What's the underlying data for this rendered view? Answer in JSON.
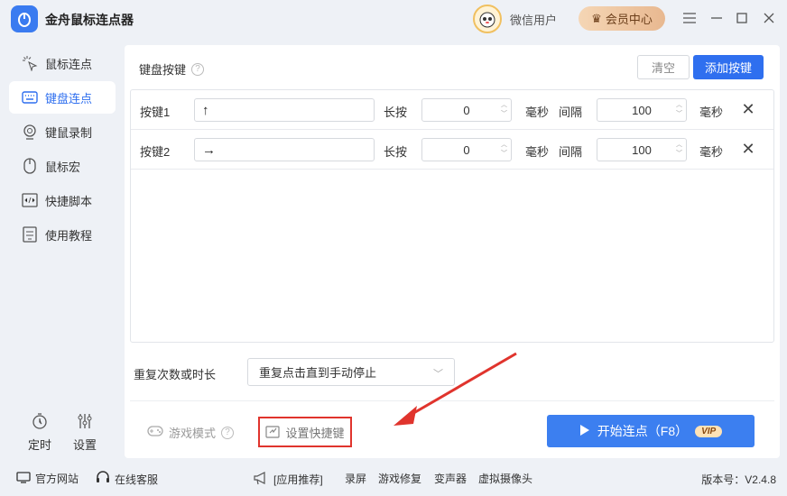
{
  "app": {
    "title": "金舟鼠标连点器",
    "user_name": "微信用户",
    "vip_label": "会员中心"
  },
  "colors": {
    "accent": "#2f6fef",
    "highlight_box": "#e0342d",
    "vip_gold": "#e8b890"
  },
  "sidebar": {
    "items": [
      {
        "label": "鼠标连点",
        "icon": "mouse-click-icon"
      },
      {
        "label": "键盘连点",
        "icon": "keyboard-icon",
        "active": true
      },
      {
        "label": "键鼠录制",
        "icon": "record-icon"
      },
      {
        "label": "鼠标宏",
        "icon": "mouse-icon"
      },
      {
        "label": "快捷脚本",
        "icon": "script-icon"
      },
      {
        "label": "使用教程",
        "icon": "tutorial-icon"
      }
    ],
    "bottom": [
      {
        "label": "定时",
        "icon": "timer-icon"
      },
      {
        "label": "设置",
        "icon": "settings-icon"
      }
    ]
  },
  "main": {
    "section_title": "键盘按键",
    "clear_label": "清空",
    "add_label": "添加按键",
    "keys": [
      {
        "label": "按键1",
        "key": "↑",
        "hold_label": "长按",
        "hold_value": "0",
        "unit1": "毫秒",
        "interval_label": "间隔",
        "interval_value": "100",
        "unit2": "毫秒"
      },
      {
        "label": "按键2",
        "key": "→",
        "hold_label": "长按",
        "hold_value": "0",
        "unit1": "毫秒",
        "interval_label": "间隔",
        "interval_value": "100",
        "unit2": "毫秒"
      }
    ],
    "repeat_label": "重复次数或时长",
    "repeat_value": "重复点击直到手动停止",
    "game_mode_label": "游戏模式",
    "hotkey_label": "设置快捷键",
    "start_label": "开始连点（F8）",
    "vip_badge": "VIP"
  },
  "footer": {
    "website": "官方网站",
    "support": "在线客服",
    "recommend": "[应用推荐]",
    "links": [
      "录屏",
      "游戏修复",
      "变声器",
      "虚拟摄像头"
    ],
    "version": "版本号：V2.4.8"
  }
}
